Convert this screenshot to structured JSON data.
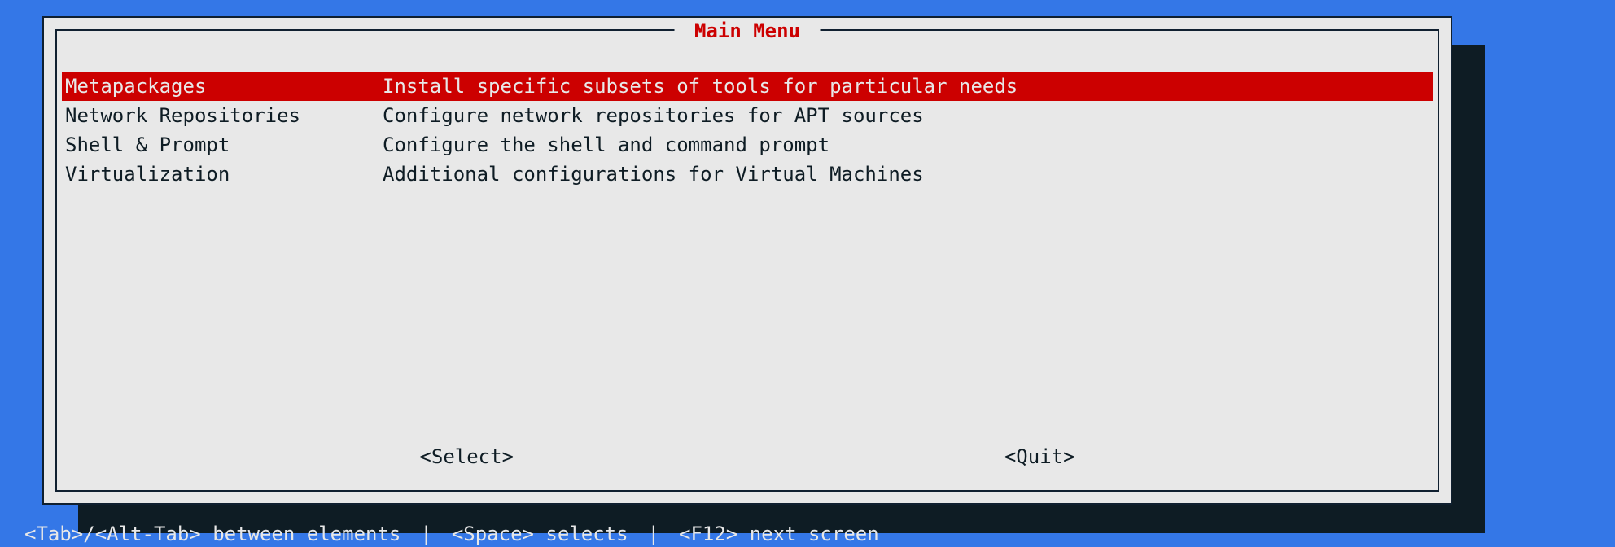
{
  "dialog": {
    "title": " Main Menu "
  },
  "menu": {
    "items": [
      {
        "name": "Metapackages",
        "desc": "Install specific subsets of tools for particular needs",
        "selected": true
      },
      {
        "name": "Network Repositories",
        "desc": "Configure network repositories for APT sources",
        "selected": false
      },
      {
        "name": "Shell & Prompt",
        "desc": "Configure the shell and command prompt",
        "selected": false
      },
      {
        "name": "Virtualization",
        "desc": "Additional configurations for Virtual Machines",
        "selected": false
      }
    ]
  },
  "buttons": {
    "select": "<Select>",
    "quit": "<Quit>"
  },
  "hints": {
    "tab": "<Tab>/<Alt-Tab> between elements",
    "space": "<Space> selects",
    "f12": "<F12> next screen",
    "sep": "|"
  },
  "colors": {
    "background": "#3477e7",
    "panel": "#e8e8e8",
    "shadow": "#0e1c24",
    "accent": "#cc0000"
  }
}
